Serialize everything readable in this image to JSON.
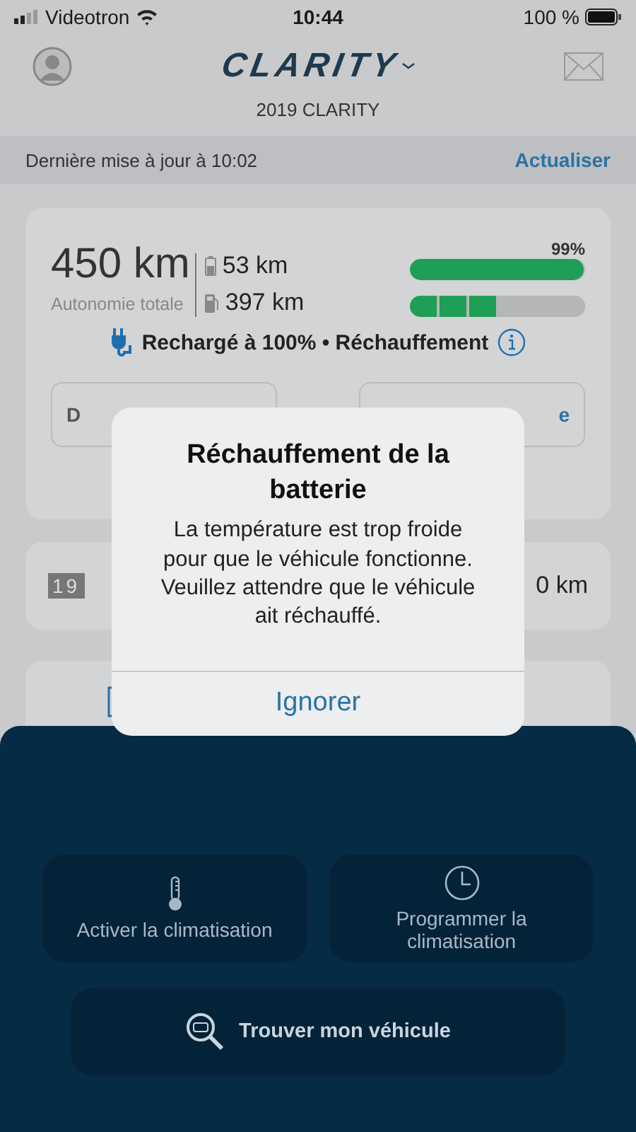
{
  "status_bar": {
    "carrier": "Videotron",
    "time": "10:44",
    "battery": "100 %"
  },
  "header": {
    "logo": "CLARITY",
    "vehicle": "2019 CLARITY"
  },
  "update_bar": {
    "text": "Dernière mise à jour à 10:02",
    "action": "Actualiser"
  },
  "range_card": {
    "total": "450 km",
    "total_label": "Autonomie totale",
    "sources": [
      {
        "kind": "battery",
        "range": "53 km",
        "percent": "99%",
        "level": 0.99
      },
      {
        "kind": "fuel",
        "range": "397 km",
        "level": 0.5
      }
    ],
    "status": "Rechargé à 100% • Réchauffement",
    "buttons": [
      "D",
      "e"
    ]
  },
  "odometer_card": {
    "digits": "19",
    "value": "0 km"
  },
  "alert": {
    "title": "Réchauffement de la batterie",
    "message": "La température est trop froide pour que le véhicule fonctionne. Veuillez attendre que le véhicule ait réchauffé.",
    "button": "Ignorer"
  },
  "actions": [
    {
      "kind": "climate",
      "label": "Activer la climatisation"
    },
    {
      "kind": "schedule",
      "label": "Programmer la climatisation"
    },
    {
      "kind": "find",
      "label": "Trouver mon véhicule"
    }
  ]
}
